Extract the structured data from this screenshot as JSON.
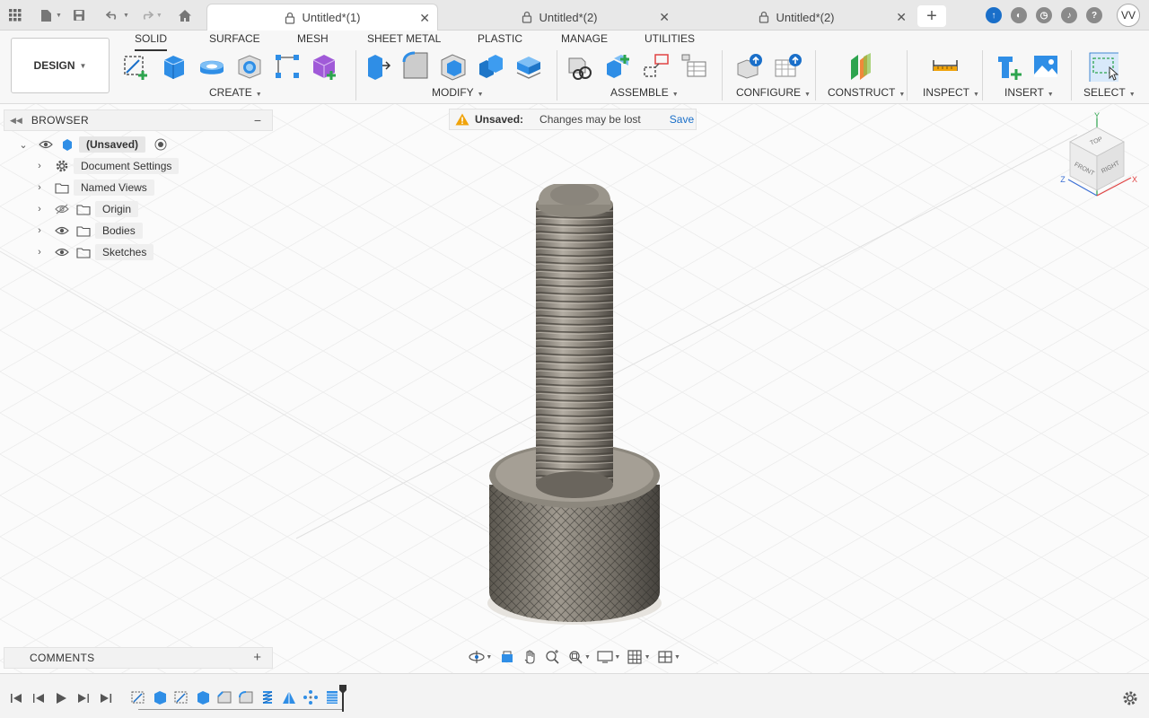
{
  "tabbar": {
    "tabs": [
      {
        "label": "Untitled*(1)",
        "active": true
      },
      {
        "label": "Untitled*(2)",
        "active": false
      },
      {
        "label": "Untitled*(2)",
        "active": false
      }
    ],
    "user_initials": "VV"
  },
  "ribbon": {
    "workspace": "DESIGN",
    "tabs": [
      "SOLID",
      "SURFACE",
      "MESH",
      "SHEET METAL",
      "PLASTIC",
      "MANAGE",
      "UTILITIES"
    ],
    "active_tab": "SOLID",
    "groups": [
      "CREATE",
      "MODIFY",
      "ASSEMBLE",
      "CONFIGURE",
      "CONSTRUCT",
      "INSPECT",
      "INSERT",
      "SELECT"
    ]
  },
  "browser": {
    "title": "BROWSER",
    "items": [
      {
        "label": "(Unsaved)",
        "icon": "component-icon"
      },
      {
        "label": "Document Settings",
        "icon": "gear-icon"
      },
      {
        "label": "Named Views",
        "icon": "folder-icon"
      },
      {
        "label": "Origin",
        "icon": "folder-icon"
      },
      {
        "label": "Bodies",
        "icon": "folder-icon"
      },
      {
        "label": "Sketches",
        "icon": "folder-icon"
      }
    ]
  },
  "banner": {
    "label": "Unsaved:",
    "message": "Changes may be lost",
    "action": "Save"
  },
  "viewcube": {
    "top": "TOP",
    "front": "FRONT",
    "right": "RIGHT",
    "axis_x": "X",
    "axis_y": "Y",
    "axis_z": "Z"
  },
  "comments": {
    "title": "COMMENTS"
  },
  "colors": {
    "accent": "#1a6fc9",
    "warning": "#f0a30a",
    "body_metal": "#8a8378"
  }
}
